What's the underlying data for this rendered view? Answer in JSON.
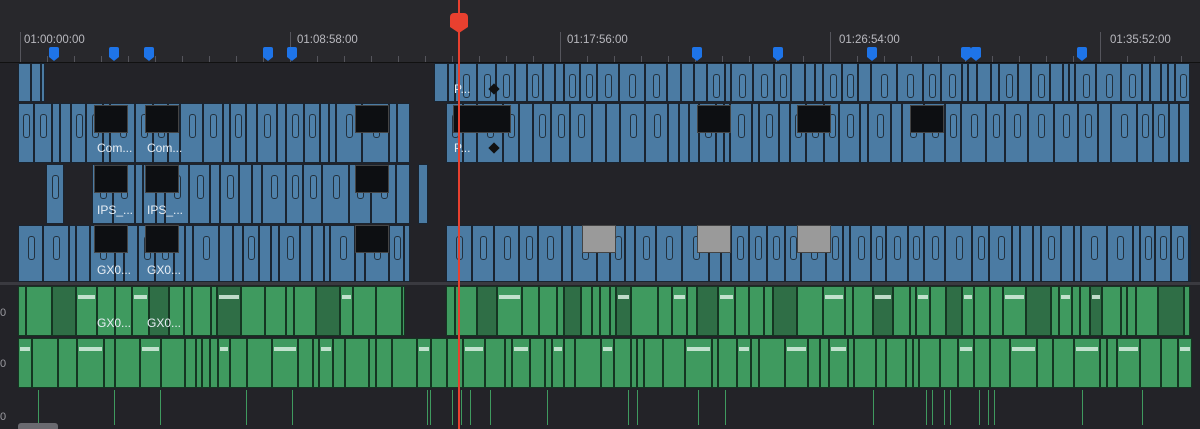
{
  "timeline": {
    "timecodes": [
      "01:00:00:00",
      "01:08:58:00",
      "01:17:56:00",
      "01:26:54:00",
      "01:35:52:00"
    ],
    "track_labels": [
      "0",
      "0",
      "0"
    ],
    "clip_labels": {
      "v4_top": "P...",
      "v3_a": "Com...",
      "v3_b": "Com...",
      "v3_c": "P...",
      "v2_a": "IPS_...",
      "v2_b": "IPS_...",
      "v1_a": "GX0...",
      "v1_b": "GX0...",
      "a1_a": "GX0...",
      "a1_b": "GX0..."
    },
    "colors": {
      "video_clip": "#4b7ba3",
      "audio_clip": "#3f9a5f",
      "playhead": "#e8402f",
      "marker": "#1e74e8"
    },
    "icons": [
      "playhead-icon",
      "marker-icon",
      "keyframe-icon"
    ]
  }
}
